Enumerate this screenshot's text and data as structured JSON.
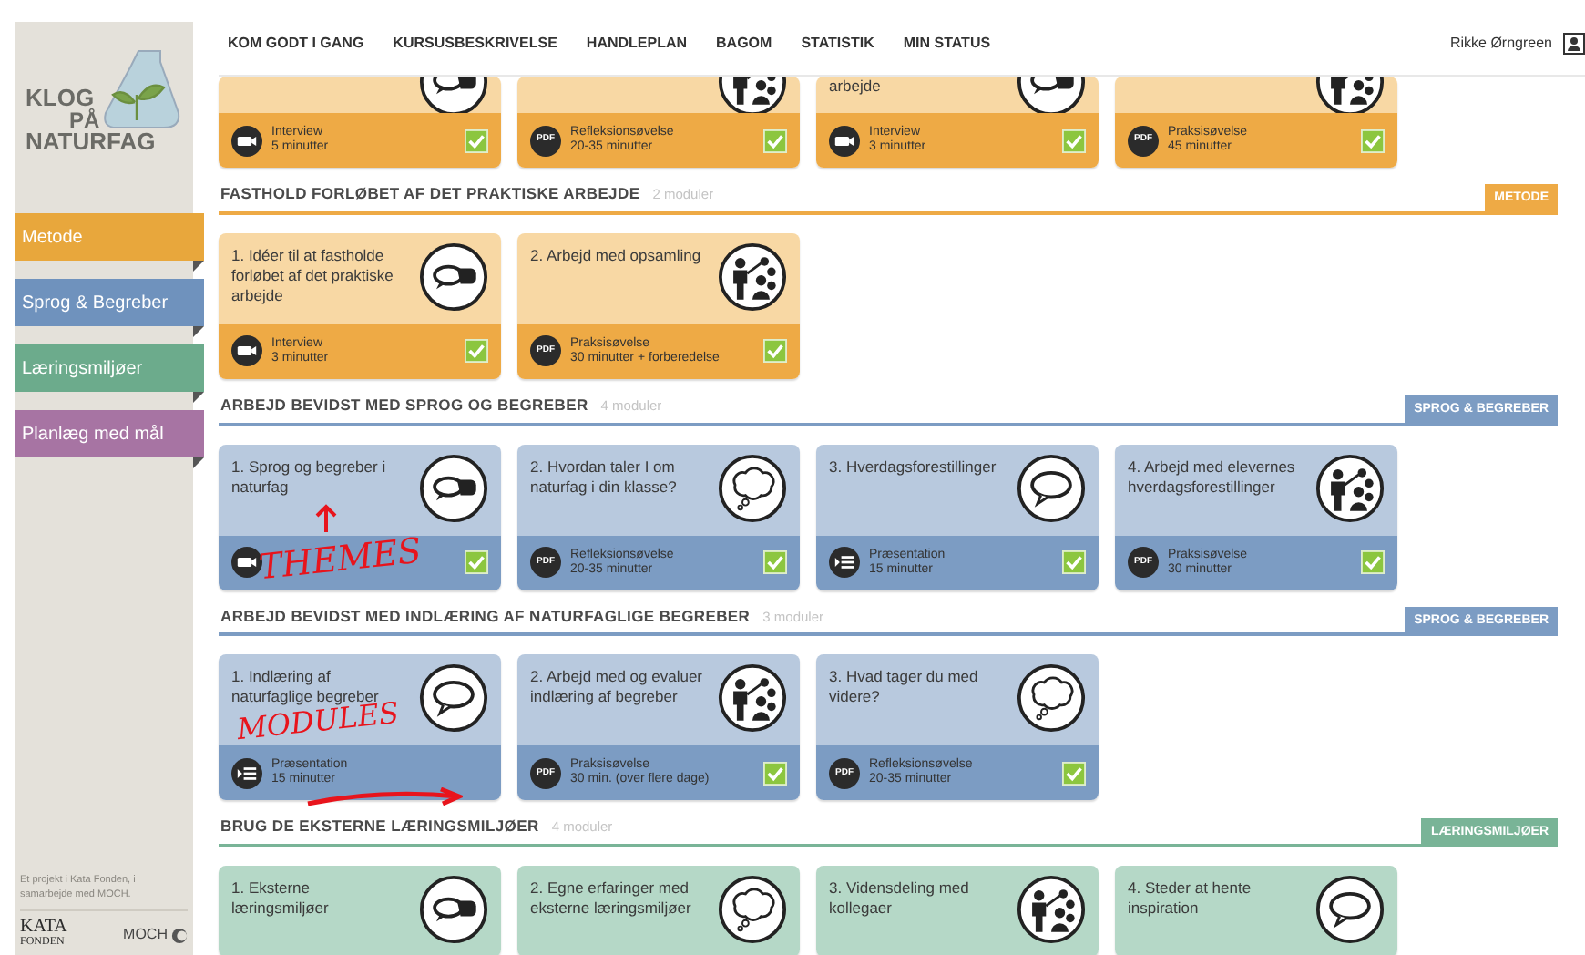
{
  "sidebar": {
    "logo": {
      "line1": "KLOG",
      "line2": "PÅ",
      "line3": "NATURFAG"
    },
    "items": [
      {
        "label": "Metode",
        "color": "#e8a73c",
        "selected": false
      },
      {
        "label": "Sprog & Begreber",
        "color": "#6f92bd",
        "selected": false
      },
      {
        "label": "Læringsmiljøer",
        "color": "#6cab8c",
        "selected": false
      },
      {
        "label": "Planlæg med mål",
        "color": "#a774a3",
        "selected": false
      }
    ],
    "credit": "Et projekt i Kata Fonden, i samarbejde med MOCH.",
    "partners": [
      "KATA",
      "FONDEN",
      "MOCH"
    ]
  },
  "nav": {
    "items": [
      "KOM GODT I GANG",
      "KURSUSBESKRIVELSE",
      "HANDLEPLAN",
      "BAGOM",
      "STATISTIK",
      "MIN STATUS"
    ],
    "user": "Rikke Ørngreen"
  },
  "top_row": {
    "kind": "metode",
    "modules": [
      {
        "kind": "speech",
        "footer": {
          "kind": "video",
          "activity": "Interview",
          "duration": "5 minutter",
          "checked": true
        }
      },
      {
        "kind": "people",
        "footer": {
          "kind": "pdf",
          "label": "PDF",
          "activity": "Refleksionsøvelse",
          "duration": "20-35 minutter",
          "checked": true
        }
      },
      {
        "title": "arbejde",
        "kind": "speech",
        "footer": {
          "kind": "video",
          "activity": "Interview",
          "duration": "3 minutter",
          "checked": true
        }
      },
      {
        "kind": "people",
        "footer": {
          "kind": "pdf",
          "label": "PDF",
          "activity": "Praksisøvelse",
          "duration": "45 minutter",
          "checked": true
        }
      }
    ]
  },
  "sections": [
    {
      "kind": "metode",
      "title": "FASTHOLD FORLØBET AF DET PRAKTISKE ARBEJDE",
      "count": "2 moduler",
      "tag": "METODE",
      "modules": [
        {
          "title": "1. Idéer til at fastholde forløbet af det praktiske arbejde",
          "kind": "speech",
          "footer": {
            "kind": "video",
            "activity": "Interview",
            "duration": "3 minutter",
            "checked": true
          }
        },
        {
          "title": "2. Arbejd med opsamling",
          "kind": "people",
          "footer": {
            "kind": "pdf",
            "label": "PDF",
            "activity": "Praksisøvelse",
            "duration": "30 minutter + forberedelse",
            "checked": true
          }
        }
      ]
    },
    {
      "kind": "sprog",
      "title": "ARBEJD BEVIDST MED SPROG OG BEGREBER",
      "count": "4 moduler",
      "tag": "SPROG & BEGREBER",
      "modules": [
        {
          "title": "1. Sprog og begreber i naturfag",
          "kind": "speech",
          "footer": {
            "kind": "video",
            "checked": true
          },
          "annotation": {
            "kind": "up",
            "text": "THEMES"
          }
        },
        {
          "title": "2. Hvordan taler I om naturfag i din klasse?",
          "kind": "thought",
          "footer": {
            "kind": "pdf",
            "label": "PDF",
            "activity": "Refleksionsøvelse",
            "duration": "20-35 minutter",
            "checked": true
          }
        },
        {
          "title": "3. Hverdagsforestillinger",
          "kind": "bubble",
          "footer": {
            "kind": "presentation",
            "activity": "Præsentation",
            "duration": "15 minutter",
            "checked": true
          }
        },
        {
          "title": "4. Arbejd med elevernes hverdagsforestillinger",
          "kind": "people",
          "footer": {
            "kind": "pdf",
            "label": "PDF",
            "activity": "Praksisøvelse",
            "duration": "30 minutter",
            "checked": true
          }
        }
      ]
    },
    {
      "kind": "sprog",
      "title": "ARBEJD BEVIDST MED INDLÆRING AF NATURFAGLIGE BEGREBER",
      "count": "3 moduler",
      "tag": "SPROG & BEGREBER",
      "modules": [
        {
          "title": "1. Indlæring af naturfaglige begreber",
          "kind": "bubble",
          "footer": {
            "kind": "presentation",
            "activity": "Præsentation",
            "duration": "15 minutter",
            "checked": false
          },
          "annotation": {
            "kind": "right",
            "text": "MODULES"
          }
        },
        {
          "title": "2. Arbejd med og evaluer indlæring af begreber",
          "kind": "people",
          "footer": {
            "kind": "pdf",
            "label": "PDF",
            "activity": "Praksisøvelse",
            "duration": "30 min. (over flere dage)",
            "checked": true
          }
        },
        {
          "title": "3. Hvad tager du med videre?",
          "kind": "thought",
          "footer": {
            "kind": "pdf",
            "label": "PDF",
            "activity": "Refleksionsøvelse",
            "duration": "20-35 minutter",
            "checked": true
          }
        }
      ]
    },
    {
      "kind": "miljo",
      "title": "BRUG DE EKSTERNE LÆRINGSMILJØER",
      "count": "4 moduler",
      "tag": "LÆRINGSMILJØER",
      "modules": [
        {
          "title": "1. Eksterne læringsmiljøer",
          "kind": "speech"
        },
        {
          "title": "2. Egne erfaringer med eksterne læringsmiljøer",
          "kind": "thought"
        },
        {
          "title": "3. Vidensdeling med kollegaer",
          "kind": "people"
        },
        {
          "title": "4. Steder at hente inspiration",
          "kind": "bubble"
        }
      ]
    }
  ]
}
